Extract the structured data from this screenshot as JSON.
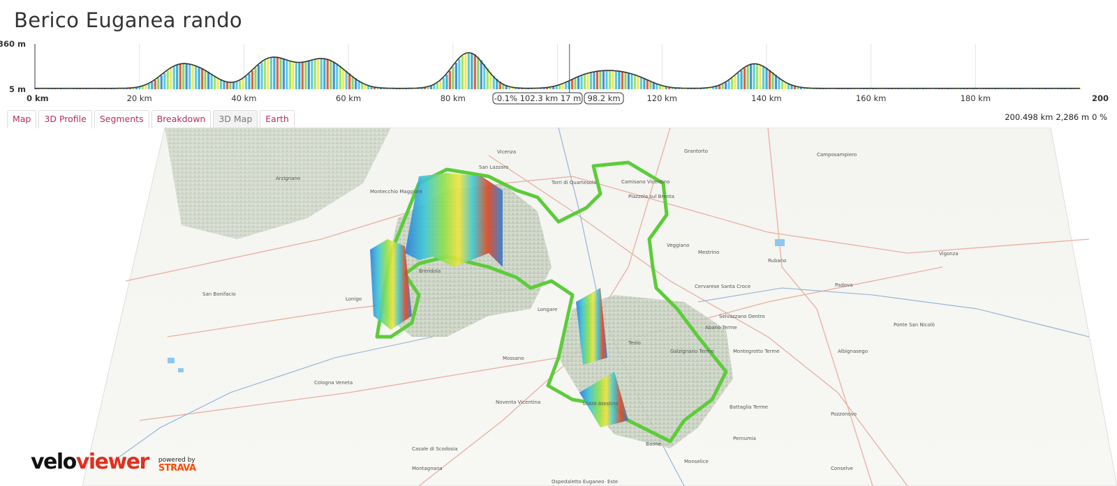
{
  "title": "Berico Euganea rando",
  "profile": {
    "y_max_label": "360 m",
    "y_min_label": "5 m",
    "x_ticks": [
      "0 km",
      "20 km",
      "40 km",
      "60 km",
      "80 km",
      "100 km",
      "120 km",
      "140 km",
      "160 km",
      "180 km",
      "200"
    ],
    "cursor_readout": "-0.1% 102.3 km 17 m",
    "cursor_distance": "98.2 km",
    "cursor_km": 102.3,
    "profile_line_color": "#333333"
  },
  "tabs": [
    {
      "label": "Map",
      "active": false
    },
    {
      "label": "3D Profile",
      "active": false
    },
    {
      "label": "Segments",
      "active": false
    },
    {
      "label": "Breakdown",
      "active": false
    },
    {
      "label": "3D Map",
      "active": true
    },
    {
      "label": "Earth",
      "active": false
    }
  ],
  "summary": {
    "distance": "200.498 km",
    "elevation": "2,286 m",
    "grade": "0 %"
  },
  "map": {
    "route_color": "#5ccc3a",
    "places": [
      "Vicenza",
      "San Lazzaro",
      "Torri di Quartesolo",
      "Camisano Vicentino",
      "Montecchio Maggiore",
      "Arzignano",
      "Brendola",
      "Lonigo",
      "Longare",
      "Mossano",
      "Noventa Vicentina",
      "Lozzo Atestino",
      "Selvazzano Dentro",
      "Abano Terme",
      "Montegrotto Terme",
      "Padova",
      "Rubano",
      "Battaglia Terme",
      "Monselice",
      "Este",
      "Cologna Veneta",
      "San Bonifacio",
      "Montagnana",
      "Ospedaletto Euganeo",
      "Conselve",
      "Veggiano",
      "Mestrino",
      "Cervarese Santa Croce",
      "Ponte San Nicolò",
      "Albignasego",
      "Vigonza",
      "Camposampiero",
      "Grantorto",
      "Piazzola sul Brenta",
      "Galzignano Terme",
      "Teolo",
      "Baone",
      "Pernumia",
      "Pozzonovo",
      "Casale di Scodosia"
    ]
  },
  "logo": {
    "velo": "velo",
    "viewer": "viewer",
    "powered_by": "powered by",
    "strava": "STRAVA"
  }
}
